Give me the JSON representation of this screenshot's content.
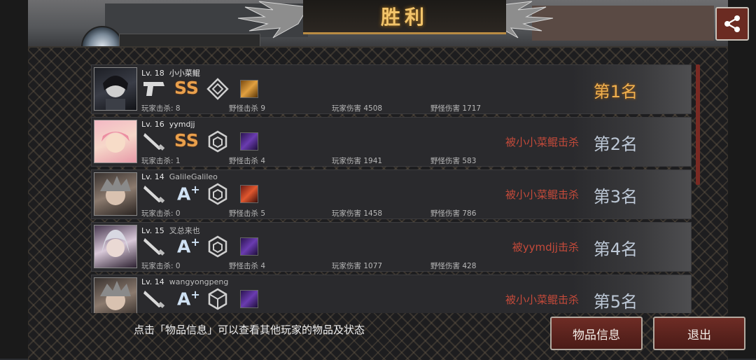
{
  "header": {
    "title": "胜利",
    "share_icon": "share-icon",
    "share_button_color": "#6b2b22"
  },
  "players": [
    {
      "level": "Lv. 18",
      "name": "小小菜鲲",
      "grade": "SS",
      "weapon": "pistol-icon",
      "badge": "diamond-badge-icon",
      "cube_color": "#c98a2a",
      "player_kills_label": "玩家击杀: 8",
      "monster_kills_label": "野怪击杀 9",
      "player_damage_label": "玩家伤害 4508",
      "monster_damage_label": "野怪伤害 1717",
      "killed_by": "",
      "rank": "第1名"
    },
    {
      "level": "Lv. 16",
      "name": "yymdjj",
      "grade": "SS",
      "weapon": "knife-icon",
      "badge": "hexagon-badge-icon",
      "cube_color": "#5a2e9a",
      "player_kills_label": "玩家击杀: 1",
      "monster_kills_label": "野怪击杀 4",
      "player_damage_label": "玩家伤害 1941",
      "monster_damage_label": "野怪伤害 583",
      "killed_by": "被小小菜鲲击杀",
      "rank": "第2名"
    },
    {
      "level": "Lv. 14",
      "name": "GalileGalileo",
      "grade": "A",
      "weapon": "knife-icon",
      "badge": "hexagon-badge-icon",
      "cube_color": "#b53a2a",
      "player_kills_label": "玩家击杀: 0",
      "monster_kills_label": "野怪击杀 5",
      "player_damage_label": "玩家伤害 1458",
      "monster_damage_label": "野怪伤害 786",
      "killed_by": "被小小菜鲲击杀",
      "rank": "第3名"
    },
    {
      "level": "Lv. 15",
      "name": "叉总来也",
      "grade": "A",
      "weapon": "knife-icon",
      "badge": "hexagon-badge-icon",
      "cube_color": "#5a2e9a",
      "player_kills_label": "玩家击杀: 0",
      "monster_kills_label": "野怪击杀 4",
      "player_damage_label": "玩家伤害 1077",
      "monster_damage_label": "野怪伤害 428",
      "killed_by": "被yymdjj击杀",
      "rank": "第4名"
    },
    {
      "level": "Lv. 14",
      "name": "wangyongpeng",
      "grade": "A",
      "weapon": "knife-icon",
      "badge": "cube-badge-icon",
      "cube_color": "#5a2e9a",
      "player_kills_label": "",
      "monster_kills_label": "",
      "player_damage_label": "",
      "monster_damage_label": "",
      "killed_by": "被小小菜鲲击杀",
      "rank": "第5名"
    }
  ],
  "footer": {
    "hint": "点击「物品信息」可以查看其他玩家的物品及状态",
    "items_button": "物品信息",
    "exit_button": "退出"
  }
}
